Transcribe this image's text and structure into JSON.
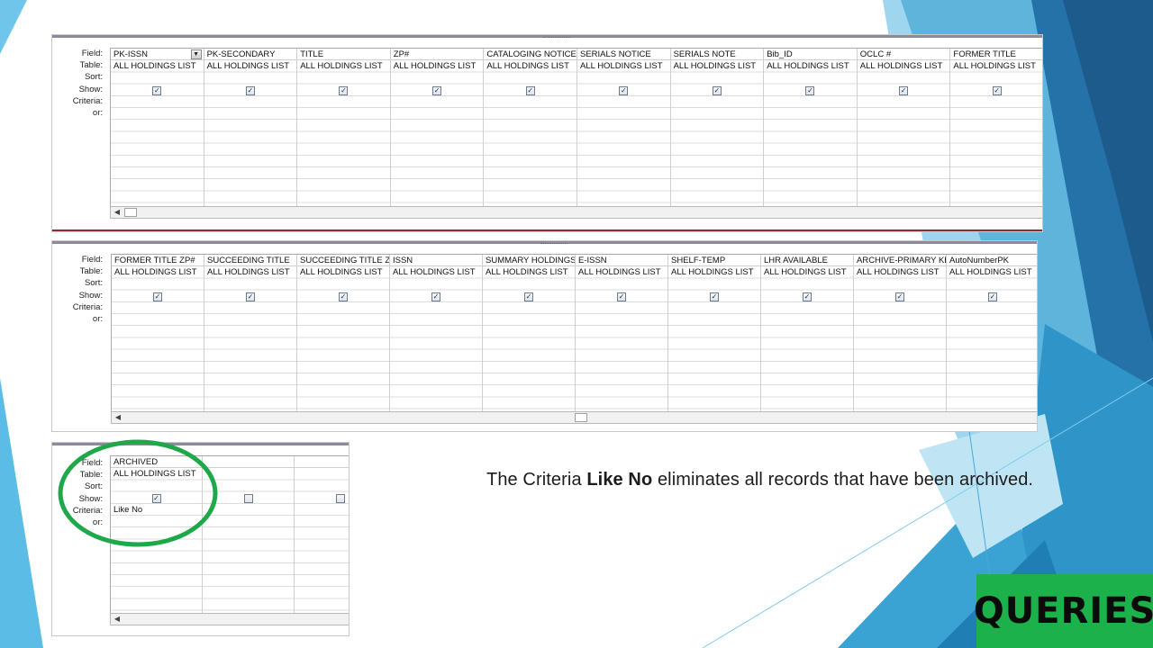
{
  "row_labels": [
    "Field:",
    "Table:",
    "Sort:",
    "Show:",
    "Criteria:",
    "or:"
  ],
  "grid1": {
    "columns": [
      {
        "field": "PK-ISSN",
        "table": "ALL HOLDINGS LIST",
        "show": true,
        "criteria": ""
      },
      {
        "field": "PK-SECONDARY",
        "table": "ALL HOLDINGS LIST",
        "show": true,
        "criteria": ""
      },
      {
        "field": "TITLE",
        "table": "ALL HOLDINGS LIST",
        "show": true,
        "criteria": ""
      },
      {
        "field": "ZP#",
        "table": "ALL HOLDINGS LIST",
        "show": true,
        "criteria": ""
      },
      {
        "field": "CATALOGING NOTICE",
        "table": "ALL HOLDINGS LIST",
        "show": true,
        "criteria": ""
      },
      {
        "field": "SERIALS NOTICE",
        "table": "ALL HOLDINGS LIST",
        "show": true,
        "criteria": ""
      },
      {
        "field": "SERIALS NOTE",
        "table": "ALL HOLDINGS LIST",
        "show": true,
        "criteria": ""
      },
      {
        "field": "Bib_ID",
        "table": "ALL HOLDINGS LIST",
        "show": true,
        "criteria": ""
      },
      {
        "field": "OCLC #",
        "table": "ALL HOLDINGS LIST",
        "show": true,
        "criteria": ""
      },
      {
        "field": "FORMER TITLE",
        "table": "ALL HOLDINGS LIST",
        "show": true,
        "criteria": ""
      }
    ]
  },
  "grid2": {
    "columns": [
      {
        "field": "FORMER TITLE ZP#",
        "table": "ALL HOLDINGS LIST",
        "show": true,
        "criteria": ""
      },
      {
        "field": "SUCCEEDING TITLE",
        "table": "ALL HOLDINGS LIST",
        "show": true,
        "criteria": ""
      },
      {
        "field": "SUCCEEDING TITLE ZP",
        "table": "ALL HOLDINGS LIST",
        "show": true,
        "criteria": ""
      },
      {
        "field": "ISSN",
        "table": "ALL HOLDINGS LIST",
        "show": true,
        "criteria": ""
      },
      {
        "field": "SUMMARY HOLDINGS",
        "table": "ALL HOLDINGS LIST",
        "show": true,
        "criteria": ""
      },
      {
        "field": "E-ISSN",
        "table": "ALL HOLDINGS LIST",
        "show": true,
        "criteria": ""
      },
      {
        "field": "SHELF-TEMP",
        "table": "ALL HOLDINGS LIST",
        "show": true,
        "criteria": ""
      },
      {
        "field": "LHR AVAILABLE",
        "table": "ALL HOLDINGS LIST",
        "show": true,
        "criteria": ""
      },
      {
        "field": "ARCHIVE-PRIMARY KE",
        "table": "ALL HOLDINGS LIST",
        "show": true,
        "criteria": ""
      },
      {
        "field": "AutoNumberPK",
        "table": "ALL HOLDINGS LIST",
        "show": true,
        "criteria": ""
      }
    ]
  },
  "grid3": {
    "columns": [
      {
        "field": "ARCHIVED",
        "table": "ALL HOLDINGS LIST",
        "show": true,
        "criteria": "Like No"
      },
      {
        "field": "",
        "table": "",
        "show": false,
        "criteria": ""
      },
      {
        "field": "",
        "table": "",
        "show": false,
        "criteria": ""
      }
    ]
  },
  "caption": {
    "before": "The Criteria ",
    "bold": "Like No",
    "after": " eliminates all records that have been archived."
  },
  "badge": {
    "label": "QUERIES"
  },
  "colors": {
    "badge": "#1db14b",
    "highlight_ellipse": "#1ea84a",
    "bg_blue_dark": "#1b5e8e",
    "bg_blue_mid": "#2a8fc4",
    "bg_blue_light": "#7cc8ea"
  }
}
